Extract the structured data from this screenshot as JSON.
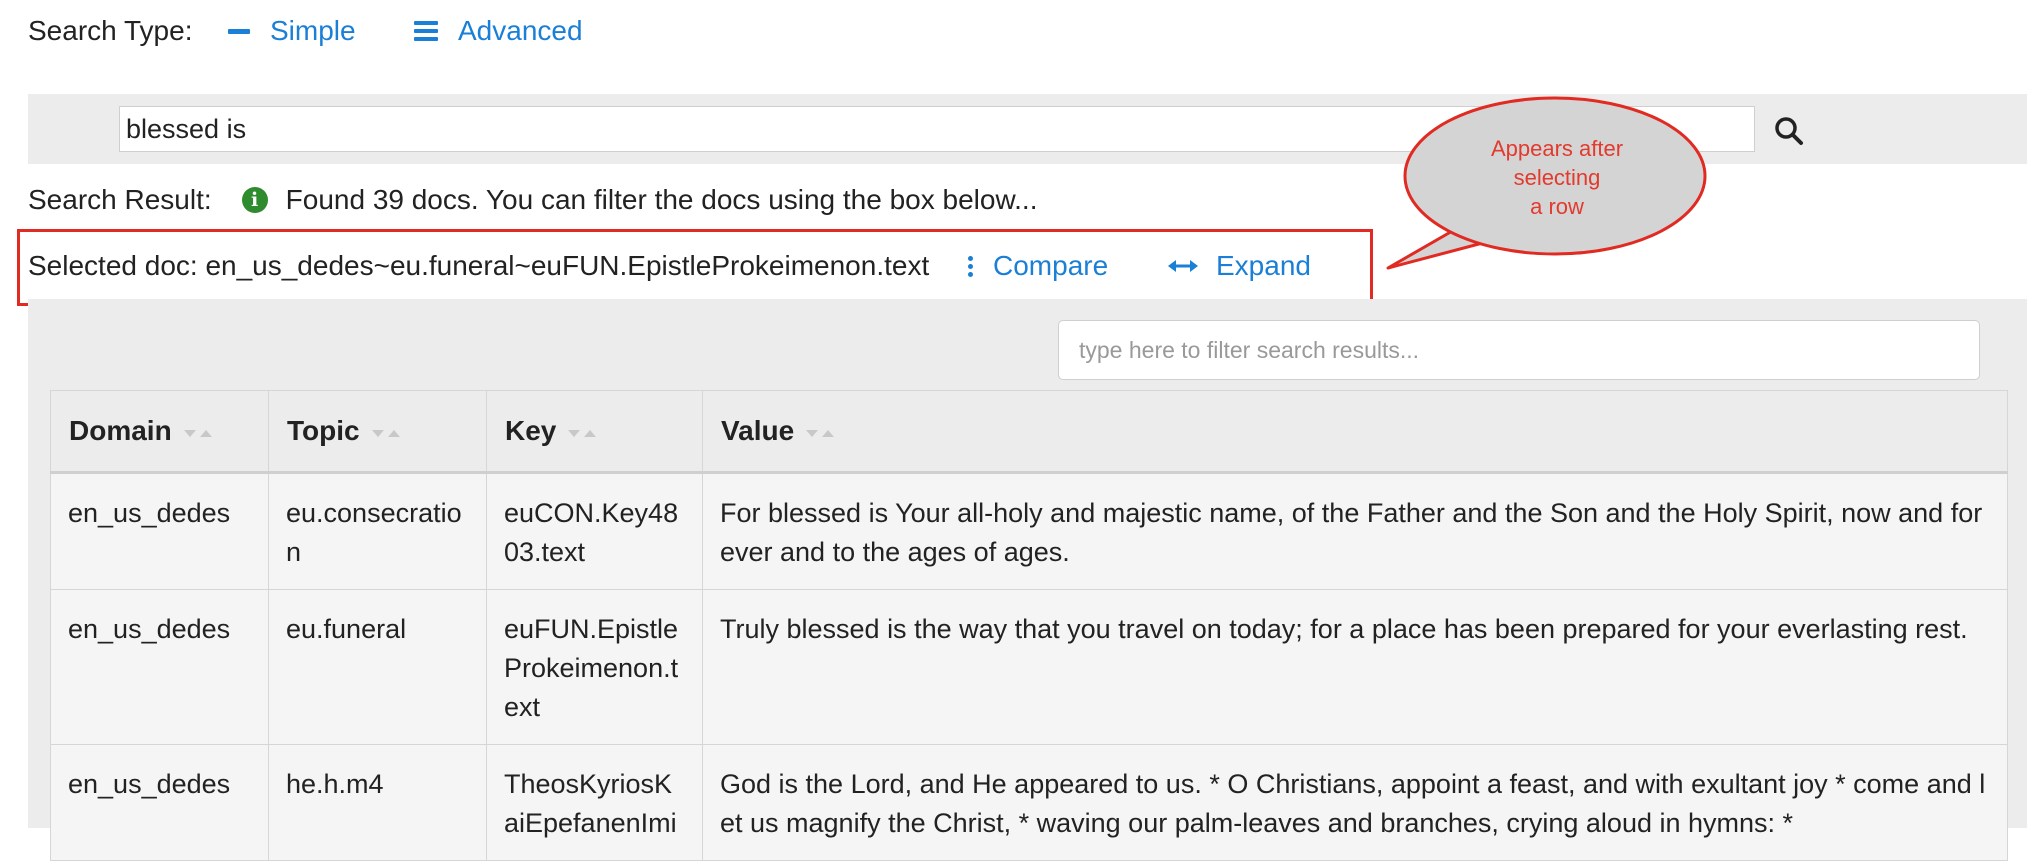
{
  "search_type": {
    "label": "Search Type:",
    "options": [
      {
        "label": "Simple",
        "icon": "minus-icon"
      },
      {
        "label": "Advanced",
        "icon": "bars-icon"
      }
    ]
  },
  "search": {
    "value": "blessed is",
    "button_icon": "search-icon"
  },
  "result": {
    "label": "Search Result:",
    "message": "Found 39 docs. You can filter the docs using the box below..."
  },
  "selected": {
    "text": "Selected doc: en_us_dedes~eu.funeral~euFUN.EpistleProkeimenon.text",
    "compare_label": "Compare",
    "expand_label": "Expand"
  },
  "callout": {
    "lines": [
      "Appears after",
      "selecting",
      "a row"
    ]
  },
  "filter": {
    "placeholder": "type here to filter search results..."
  },
  "table": {
    "columns": [
      "Domain",
      "Topic",
      "Key",
      "Value"
    ],
    "rows": [
      {
        "domain": "en_us_dedes",
        "topic": "eu.consecration",
        "key": "euCON.Key4803.text",
        "value": "For blessed is Your all-holy and majestic name, of the Father and the Son and the Holy Spirit, now and forever and to the ages of ages."
      },
      {
        "domain": "en_us_dedes",
        "topic": "eu.funeral",
        "key": "euFUN.EpistleProkeimenon.text",
        "value": "Truly blessed is the way that you travel on today; for a place has been prepared for your everlasting rest."
      },
      {
        "domain": "en_us_dedes",
        "topic": "he.h.m4",
        "key": "TheosKyriosKaiEpefanenImi",
        "value": "God is the Lord, and He appeared to us. * O Christians, appoint a feast, and with exultant joy * come and let us magnify the Christ, * waving our palm-leaves and branches, crying aloud in hymns: *"
      }
    ]
  },
  "colors": {
    "link": "#1a7fd6",
    "highlight_border": "#e02a22",
    "callout_fill": "#d4d4d4",
    "callout_text": "#e33a2e",
    "info_icon": "#2e8b2e"
  }
}
